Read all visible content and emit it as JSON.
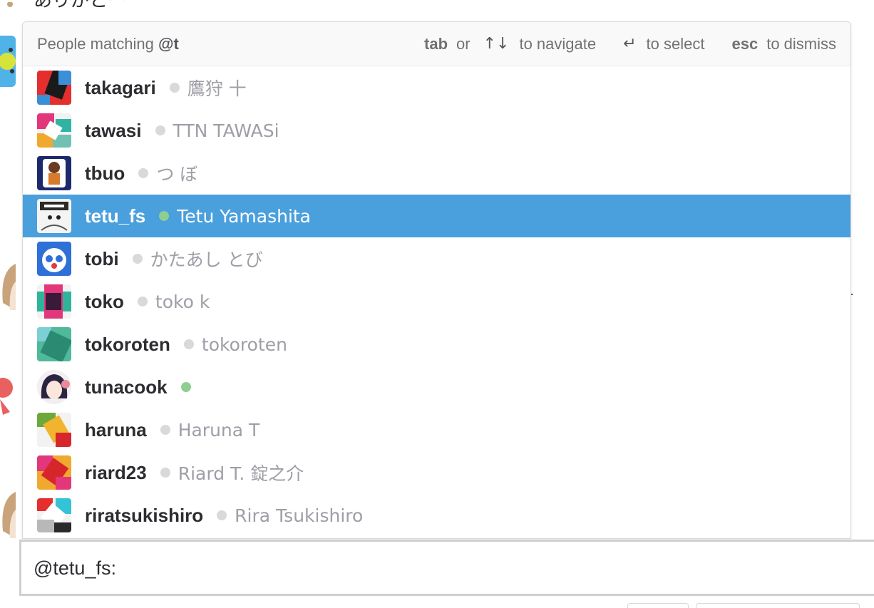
{
  "background": {
    "partial_message": "ありがとー"
  },
  "mention_popup": {
    "title_prefix": "People matching",
    "query": "@t",
    "hints": [
      {
        "key": "tab",
        "text": "or"
      },
      {
        "key": "↑↓",
        "text": "to navigate"
      },
      {
        "key": "↵",
        "text": "to select"
      },
      {
        "key": "esc",
        "text": "to dismiss"
      }
    ],
    "selected_index": 3,
    "people": [
      {
        "username": "takagari",
        "real_name": "鷹狩 十",
        "online": false,
        "avatar": "identicon-red-black-blue"
      },
      {
        "username": "tawasi",
        "real_name": "TTN TAWASi",
        "online": false,
        "avatar": "identicon-pink-green-yellow"
      },
      {
        "username": "tbuo",
        "real_name": "つ ぼ",
        "online": false,
        "avatar": "photo-character-orange"
      },
      {
        "username": "tetu_fs",
        "real_name": "Tetu Yamashita",
        "online": true,
        "avatar": "photo-manga-face"
      },
      {
        "username": "tobi",
        "real_name": "かたあし とび",
        "online": false,
        "avatar": "photo-blue-character"
      },
      {
        "username": "toko",
        "real_name": "toko k",
        "online": false,
        "avatar": "identicon-pink-teal-dark"
      },
      {
        "username": "tokoroten",
        "real_name": "tokoroten",
        "online": false,
        "avatar": "identicon-teal-green"
      },
      {
        "username": "tunacook",
        "real_name": "",
        "online": true,
        "avatar": "photo-anime-girl"
      },
      {
        "username": "haruna",
        "real_name": "Haruna T",
        "online": false,
        "avatar": "identicon-green-yellow-red"
      },
      {
        "username": "riard23",
        "real_name": "Riard T. 錠之介",
        "online": false,
        "avatar": "identicon-pink-red-orange"
      },
      {
        "username": "riratsukishiro",
        "real_name": "Rira Tsukishiro",
        "online": false,
        "avatar": "identicon-red-cyan-grey"
      }
    ]
  },
  "composer": {
    "value": "@tetu_fs:"
  },
  "colors": {
    "selected_row": "#4a9fdd",
    "presence_online": "#8fcd90",
    "presence_away": "#d9d9d9"
  }
}
